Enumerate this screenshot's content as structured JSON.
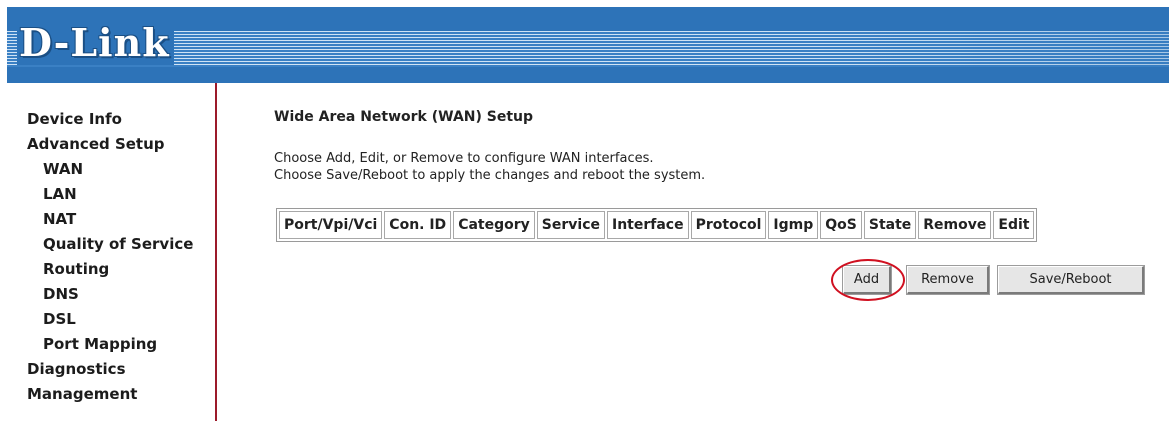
{
  "header": {
    "logo_text": "D-Link"
  },
  "sidebar": {
    "items": [
      {
        "label": "Device Info",
        "level": 0
      },
      {
        "label": "Advanced Setup",
        "level": 0
      },
      {
        "label": "WAN",
        "level": 1
      },
      {
        "label": "LAN",
        "level": 1
      },
      {
        "label": "NAT",
        "level": 1
      },
      {
        "label": "Quality of Service",
        "level": 1
      },
      {
        "label": "Routing",
        "level": 1
      },
      {
        "label": "DNS",
        "level": 1
      },
      {
        "label": "DSL",
        "level": 1
      },
      {
        "label": "Port Mapping",
        "level": 1
      },
      {
        "label": "Diagnostics",
        "level": 0
      },
      {
        "label": "Management",
        "level": 0
      }
    ]
  },
  "main": {
    "title": "Wide Area Network (WAN) Setup",
    "desc_line1": "Choose Add, Edit, or Remove to configure WAN interfaces.",
    "desc_line2": "Choose Save/Reboot to apply the changes and reboot the system.",
    "table": {
      "columns": [
        "Port/Vpi/Vci",
        "Con. ID",
        "Category",
        "Service",
        "Interface",
        "Protocol",
        "Igmp",
        "QoS",
        "State",
        "Remove",
        "Edit"
      ]
    },
    "buttons": {
      "add": "Add",
      "remove": "Remove",
      "save_reboot": "Save/Reboot"
    }
  },
  "colors": {
    "header_blue": "#2d73b8",
    "sidebar_divider": "#9c1a2a",
    "highlight_circle": "#d01020"
  }
}
